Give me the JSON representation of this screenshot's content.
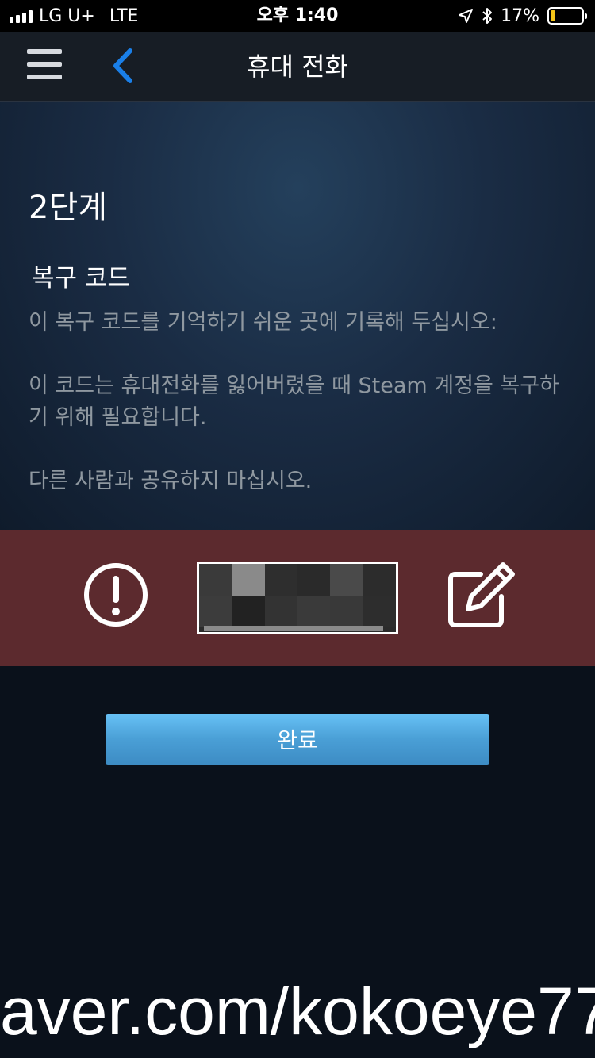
{
  "status_bar": {
    "carrier": "LG U+",
    "network": "LTE",
    "time": "오후 1:40",
    "battery_percent": "17%",
    "battery_level": 0.17,
    "battery_color": "#f5c518"
  },
  "nav": {
    "title": "휴대 전화",
    "menu_icon": "hamburger-menu-icon",
    "back_icon": "chevron-left-icon",
    "back_color": "#1a7fe8"
  },
  "content": {
    "step": "2단계",
    "section_title": "복구 코드",
    "paragraph1": "이 복구 코드를 기억하기 쉬운 곳에 기록해 두십시오:",
    "paragraph2": "이 코드는 휴대전화를 잃어버렸을 때 Steam 계정을 복구하기 위해 필요합니다.",
    "paragraph3": "다른 사람과 공유하지 마십시오."
  },
  "code_band": {
    "background": "#5c2a2e",
    "alert_icon": "exclamation-circle-icon",
    "edit_icon": "edit-pencil-icon"
  },
  "actions": {
    "done_label": "완료"
  },
  "watermark": {
    "text": "aver.com/kokoeye77"
  }
}
